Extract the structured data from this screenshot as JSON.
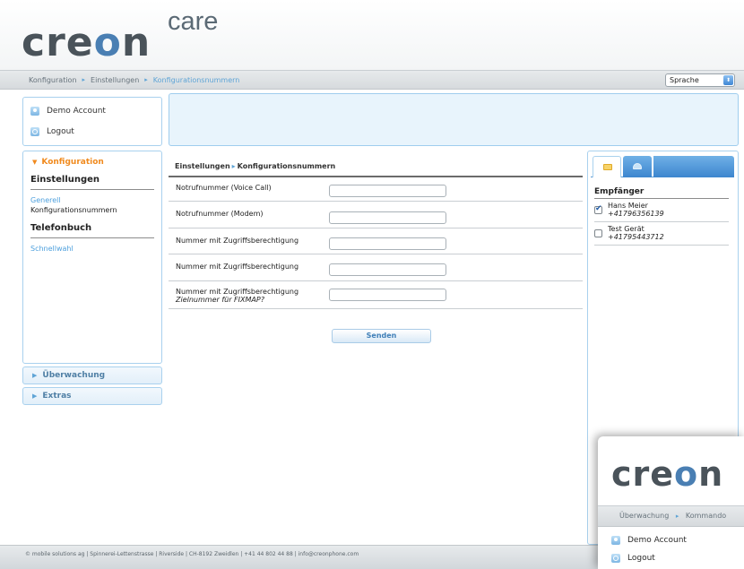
{
  "logo": {
    "main_pre": "cre",
    "main_o": "o",
    "main_post": "n",
    "sub": "care"
  },
  "breadcrumb": {
    "items": [
      "Konfiguration",
      "Einstellungen",
      "Konfigurationsnummern"
    ],
    "separator": "▸"
  },
  "language_select": {
    "value": "Sprache",
    "arrow": "⬍"
  },
  "account": {
    "user_label": "Demo Account",
    "logout_label": "Logout"
  },
  "nav": {
    "active_section": "Konfiguration",
    "groups": [
      {
        "title": "Einstellungen",
        "links": [
          "Generell",
          "Konfigurationsnummern"
        ]
      },
      {
        "title": "Telefonbuch",
        "links": [
          "Schnellwahl"
        ]
      }
    ],
    "collapsed": [
      "Überwachung",
      "Extras"
    ]
  },
  "form": {
    "heading_a": "Einstellungen",
    "heading_b": "Konfigurationsnummern",
    "rows": [
      {
        "label": "Notrufnummer (Voice Call)",
        "sub": "",
        "value": ""
      },
      {
        "label": "Notrufnummer (Modem)",
        "sub": "",
        "value": ""
      },
      {
        "label": "Nummer mit Zugriffsberechtigung",
        "sub": "",
        "value": ""
      },
      {
        "label": "Nummer mit Zugriffsberechtigung",
        "sub": "",
        "value": ""
      },
      {
        "label": "Nummer mit Zugriffsberechtigung",
        "sub": "Zielnummer für FIXMAP?",
        "value": ""
      }
    ],
    "submit_label": "Senden"
  },
  "recipients": {
    "title": "Empfänger",
    "items": [
      {
        "name": "Hans Meier",
        "phone": "+41796356139",
        "checked": true
      },
      {
        "name": "Test Gerät",
        "phone": "+41795443712",
        "checked": false
      }
    ]
  },
  "footer": {
    "text": "© mobile solutions ag | Spinnerei-Lettenstrasse | Riverside | CH-8192 Zweidlen | +41 44 802 44 88 | info@creonphone.com"
  },
  "second_window": {
    "logo_pre": "cre",
    "logo_o": "o",
    "logo_post": "n",
    "breadcrumb": [
      "Überwachung",
      "Kommando"
    ],
    "user_label": "Demo Account",
    "logout_label": "Logout"
  },
  "colors": {
    "accent": "#5ea4d6",
    "active_orange": "#f08a1e",
    "panel_border": "#a9d1ee"
  }
}
